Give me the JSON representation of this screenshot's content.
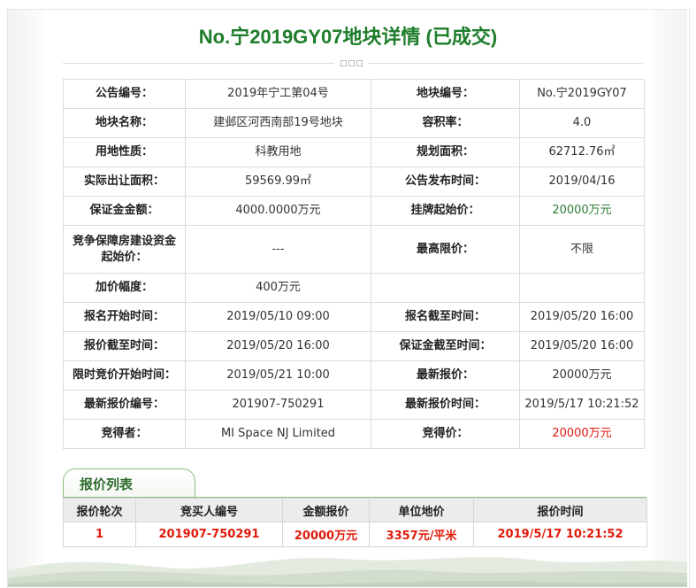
{
  "title": "No.宁2019GY07地块详情 (已成交)",
  "detail_rows": [
    [
      {
        "label": "公告编号：",
        "value": "2019年宁工第04号"
      },
      {
        "label": "地块编号：",
        "value": "No.宁2019GY07"
      }
    ],
    [
      {
        "label": "地块名称：",
        "value": "建邺区河西南部19号地块"
      },
      {
        "label": "容积率：",
        "value": "4.0"
      }
    ],
    [
      {
        "label": "用地性质：",
        "value": "科教用地"
      },
      {
        "label": "规划面积：",
        "value": "62712.76㎡"
      }
    ],
    [
      {
        "label": "实际出让面积：",
        "value": "59569.99㎡"
      },
      {
        "label": "公告发布时间：",
        "value": "2019/04/16"
      }
    ],
    [
      {
        "label": "保证金金额：",
        "value": "4000.0000万元"
      },
      {
        "label": "挂牌起始价：",
        "value": "20000万元"
      }
    ],
    [
      {
        "label": "竞争保障房建设资金起始价：",
        "value": "---"
      },
      {
        "label": "最高限价：",
        "value": "不限"
      }
    ],
    [
      {
        "label": "加价幅度：",
        "value": "400万元"
      },
      {
        "label": "",
        "value": ""
      }
    ],
    [
      {
        "label": "报名开始时间：",
        "value": "2019/05/10 09:00"
      },
      {
        "label": "报名截至时间：",
        "value": "2019/05/20 16:00"
      }
    ],
    [
      {
        "label": "报价截至时间：",
        "value": "2019/05/20 16:00"
      },
      {
        "label": "保证金截至时间：",
        "value": "2019/05/20 16:00"
      }
    ],
    [
      {
        "label": "限时竞价开始时间：",
        "value": "2019/05/21 10:00"
      },
      {
        "label": "最新报价：",
        "value": "20000万元"
      }
    ],
    [
      {
        "label": "最新报价编号：",
        "value": "201907-750291"
      },
      {
        "label": "最新报价时间：",
        "value": "2019/5/17 10:21:52"
      }
    ],
    [
      {
        "label": "竞得者：",
        "value": "MI Space NJ Limited"
      },
      {
        "label": "竞得价：",
        "value": "20000万元"
      }
    ]
  ],
  "bid_list": {
    "tab_label": "报价列表",
    "headers": [
      "报价轮次",
      "竞买人编号",
      "金额报价",
      "单位地价",
      "报价时间"
    ],
    "rows": [
      [
        "1",
        "201907-750291",
        "20000万元",
        "3357元/平米",
        "2019/5/17 10:21:52"
      ]
    ]
  },
  "colors": {
    "title_green": "#1e7d2b",
    "highlight_green": "#2d7d32",
    "highlight_red": "#e0190a",
    "tab_border": "#8cc07a"
  }
}
